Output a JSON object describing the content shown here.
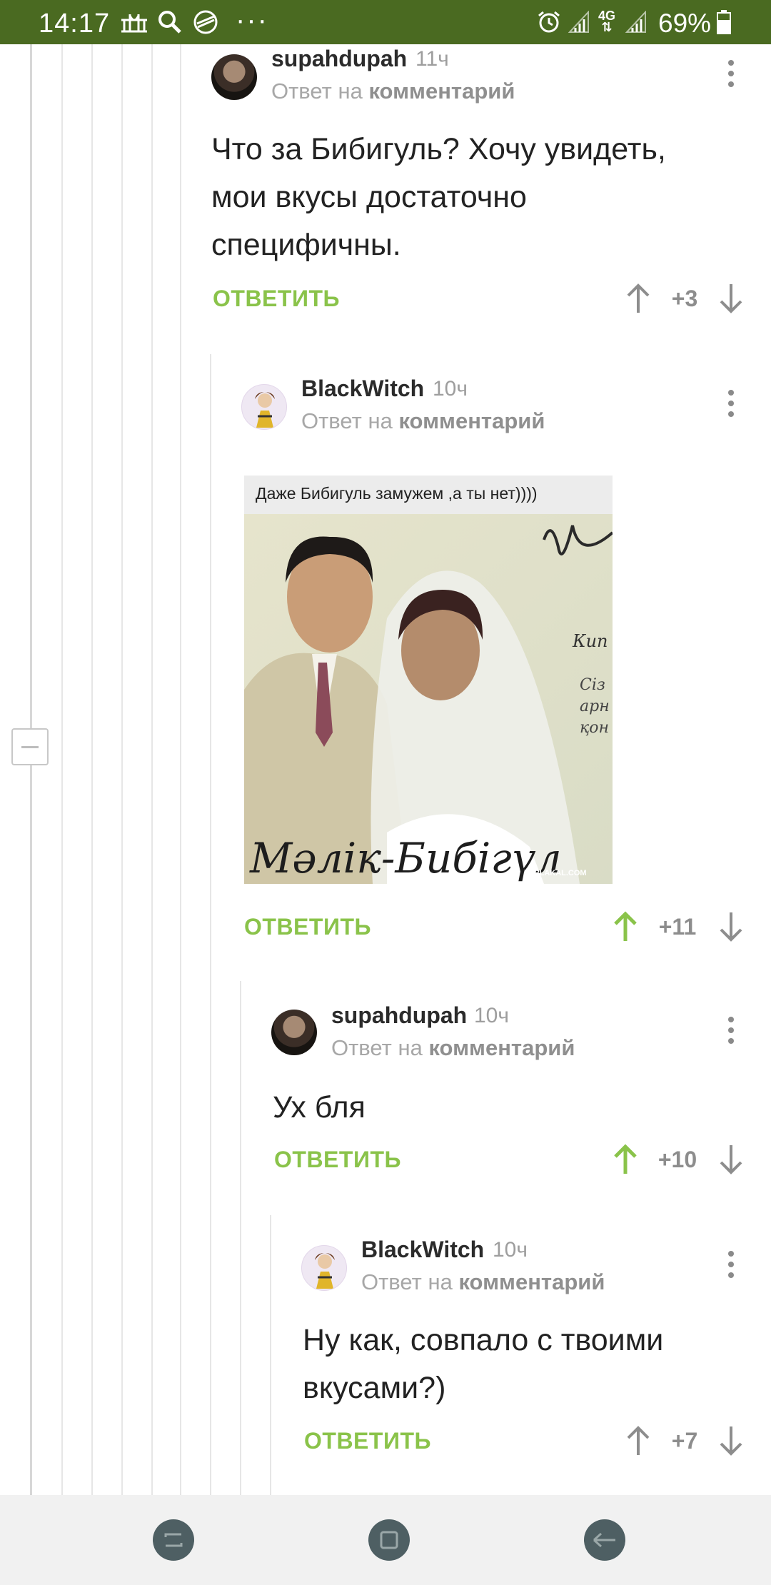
{
  "status_bar": {
    "time": "14:17",
    "dots": "···",
    "network": "4G",
    "battery": "69%"
  },
  "comments": [
    {
      "username": "supahdupah",
      "time": "11ч",
      "reply_to_prefix": "Ответ на",
      "reply_to_link": "комментарий",
      "lines": [
        "Что за Бибигуль? Хочу увидеть,",
        "мои вкусы достаточно",
        "специфичны."
      ],
      "reply_label": "ОТВЕТИТЬ",
      "score": "+3",
      "upvoted": false
    },
    {
      "username": "BlackWitch",
      "time": "10ч",
      "reply_to_prefix": "Ответ на",
      "reply_to_link": "комментарий",
      "image": {
        "caption": "Даже Бибигуль замужем ,а ты нет))))",
        "inscription": "Мәлік-Бибігүл",
        "watermark": "YAPLAKAL.COM"
      },
      "reply_label": "ОТВЕТИТЬ",
      "score": "+11",
      "upvoted": true
    },
    {
      "username": "supahdupah",
      "time": "10ч",
      "reply_to_prefix": "Ответ на",
      "reply_to_link": "комментарий",
      "lines": [
        "Ух бля"
      ],
      "reply_label": "ОТВЕТИТЬ",
      "score": "+10",
      "upvoted": true
    },
    {
      "username": "BlackWitch",
      "time": "10ч",
      "reply_to_prefix": "Ответ на",
      "reply_to_link": "комментарий",
      "lines": [
        "Ну как, совпало с твоими",
        "вкусами?)"
      ],
      "reply_label": "ОТВЕТИТЬ",
      "score": "+7",
      "upvoted": false
    }
  ],
  "colors": {
    "status_bar": "#4a6a21",
    "accent_green": "#8ac34a",
    "muted": "#8d8d8d"
  }
}
